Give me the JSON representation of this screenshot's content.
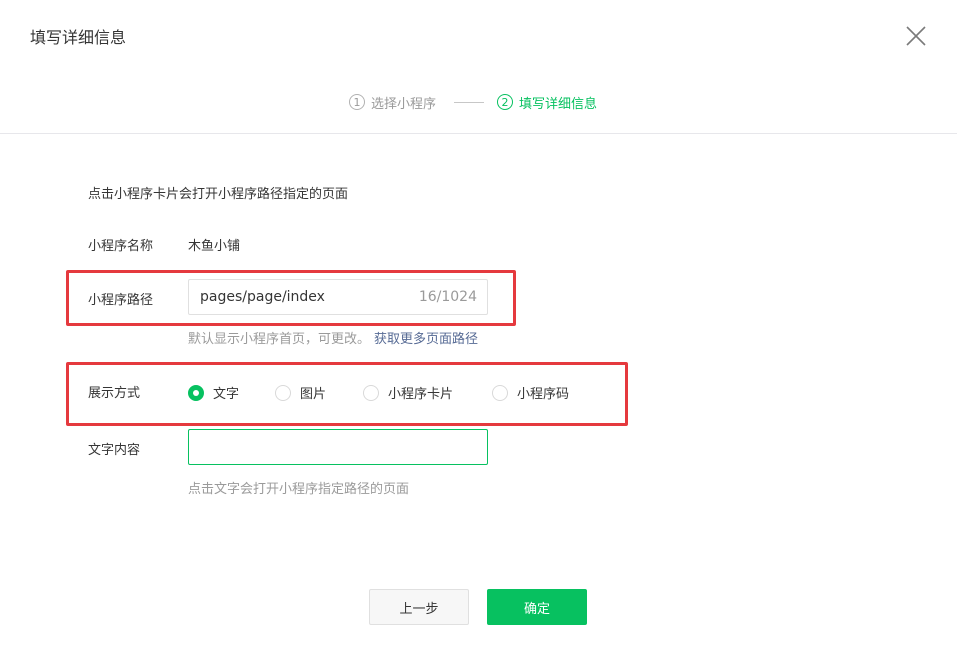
{
  "dialog": {
    "title": "填写详细信息"
  },
  "steps": [
    {
      "num": "1",
      "label": "选择小程序"
    },
    {
      "num": "2",
      "label": "填写详细信息"
    }
  ],
  "form": {
    "description": "点击小程序卡片会打开小程序路径指定的页面",
    "name_label": "小程序名称",
    "name_value": "木鱼小铺",
    "path_label": "小程序路径",
    "path_value": "pages/page/index",
    "path_count": "16/1024",
    "path_tip": "默认显示小程序首页，可更改。",
    "path_tip_link": "获取更多页面路径",
    "display_label": "展示方式",
    "display_options": [
      "文字",
      "图片",
      "小程序卡片",
      "小程序码"
    ],
    "display_selected": "文字",
    "text_label": "文字内容",
    "text_value": "",
    "text_tip": "点击文字会打开小程序指定路径的页面"
  },
  "buttons": {
    "prev": "上一步",
    "confirm": "确定"
  },
  "colors": {
    "accent": "#07c160",
    "highlight": "#e5393e",
    "link": "#576b95"
  }
}
